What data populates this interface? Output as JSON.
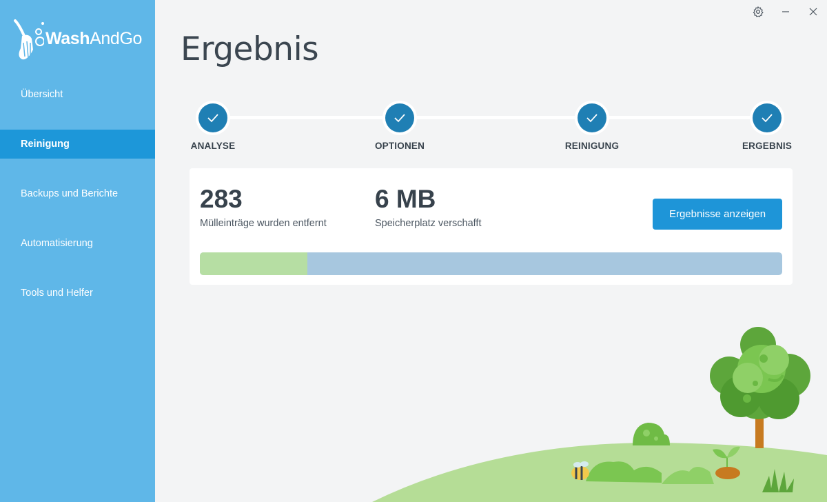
{
  "app": {
    "logo_wash": "Wash",
    "logo_andgo": "AndGo"
  },
  "sidebar": {
    "items": [
      {
        "label": "Übersicht",
        "active": false
      },
      {
        "label": "Reinigung",
        "active": true
      },
      {
        "label": "Backups und Berichte",
        "active": false
      },
      {
        "label": "Automatisierung",
        "active": false
      },
      {
        "label": "Tools und Helfer",
        "active": false
      }
    ]
  },
  "window": {
    "icons": [
      "gear-icon",
      "minimize-icon",
      "close-icon"
    ]
  },
  "main": {
    "title": "Ergebnis",
    "steps": [
      {
        "label": "ANALYSE",
        "done": true
      },
      {
        "label": "OPTIONEN",
        "done": true
      },
      {
        "label": "REINIGUNG",
        "done": true
      },
      {
        "label": "ERGEBNIS",
        "done": true
      }
    ],
    "stats": {
      "entries_value": "283",
      "entries_label": "Mülleinträge wurden entfernt",
      "space_value": "6 MB",
      "space_label": "Speicherplatz verschafft"
    },
    "results_button": "Ergebnisse anzeigen",
    "progress_fraction": 0.185
  },
  "colors": {
    "sidebar": "#5fb7e8",
    "sidebar_active": "#1d97d9",
    "step_done": "#1f7fb4",
    "button": "#1e95d8",
    "progress_done": "#b6dea3",
    "progress_rest": "#a7c7df"
  }
}
